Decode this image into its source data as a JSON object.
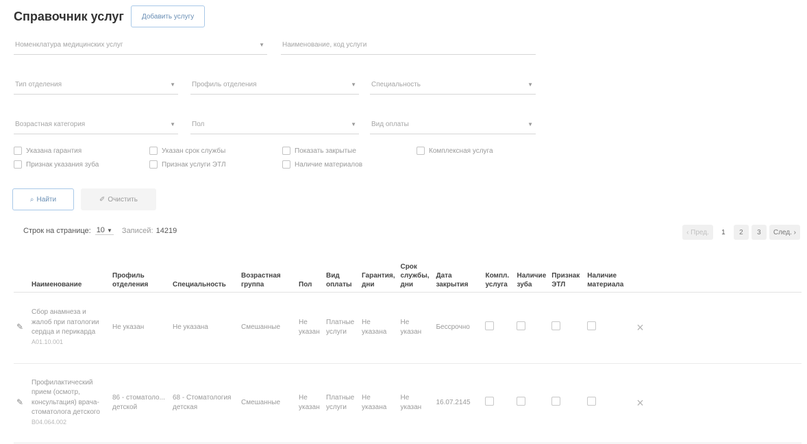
{
  "header": {
    "title": "Справочник услуг",
    "add_button": "Добавить услугу"
  },
  "filters": {
    "nomenclature": "Номенклатура медицинских услуг",
    "name_code": "Наименование, код услуги",
    "dept_type": "Тип отделения",
    "dept_profile": "Профиль отделения",
    "specialty": "Специальность",
    "age_category": "Возрастная категория",
    "sex": "Пол",
    "payment_type": "Вид оплаты"
  },
  "checkboxes": {
    "warranty": "Указана гарантия",
    "service_life": "Указан срок службы",
    "show_closed": "Показать закрытые",
    "complex": "Комплексная услуга",
    "tooth": "Признак указания зуба",
    "etl": "Признак услуги ЭТЛ",
    "materials": "Наличие материалов"
  },
  "actions": {
    "search": "Найти",
    "clear": "Очистить"
  },
  "pager": {
    "rows_label": "Строк на странице:",
    "rows_value": "10",
    "records_label": "Записей:",
    "records_value": "14219",
    "prev": "‹ Пред.",
    "next": "След. ›",
    "pages": [
      "1",
      "2",
      "3"
    ]
  },
  "table": {
    "headers": {
      "name": "Наименование",
      "profile": "Профиль отделения",
      "specialty": "Специальность",
      "age": "Возрастная группа",
      "sex": "Пол",
      "payment": "Вид оплаты",
      "warranty": "Гарантия, дни",
      "life": "Срок службы, дни",
      "close_date": "Дата закрытия",
      "complex": "Компл. услуга",
      "tooth": "Наличие зуба",
      "etl": "Признак ЭТЛ",
      "material": "Наличие материала"
    },
    "rows": [
      {
        "name": "Сбор анамнеза и жалоб при патологии сердца и перикарда",
        "code": "A01.10.001",
        "profile": "Не указан",
        "specialty": "Не указана",
        "age": "Смешанные",
        "sex": "Не указан",
        "payment": "Платные услуги",
        "warranty": "Не указана",
        "life": "Не указан",
        "close_date": "Бессрочно"
      },
      {
        "name": "Профилактический прием (осмотр, консультация) врача-стоматолога детского",
        "code": "B04.064.002",
        "profile": "86 - стоматоло... детской",
        "specialty": "68 - Стоматология детская",
        "age": "Смешанные",
        "sex": "Не указан",
        "payment": "Платные услуги",
        "warranty": "Не указана",
        "life": "Не указан",
        "close_date": "16.07.2145"
      }
    ]
  }
}
